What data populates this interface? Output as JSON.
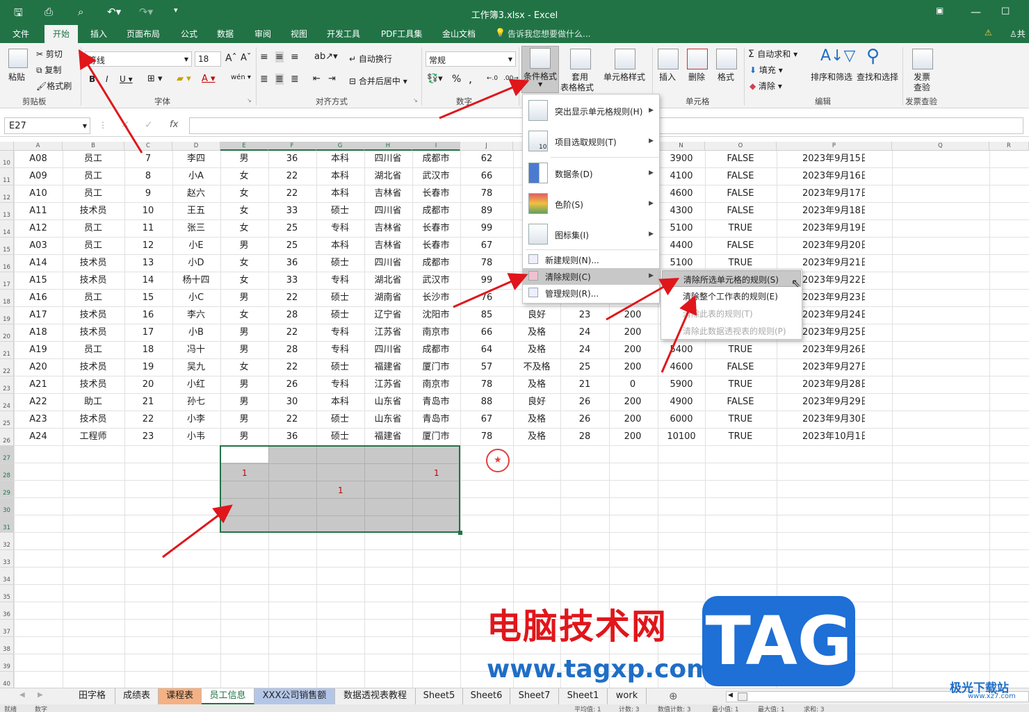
{
  "window_title": "工作簿3.xlsx - Excel",
  "ribbon_tabs": [
    "文件",
    "开始",
    "插入",
    "页面布局",
    "公式",
    "数据",
    "审阅",
    "视图",
    "开发工具",
    "PDF工具集",
    "金山文档"
  ],
  "tell_me": "告诉我您想要做什么...",
  "share_label": "共",
  "clipboard": {
    "paste": "粘贴",
    "cut": "剪切",
    "copy": "复制",
    "format_painter": "格式刷",
    "group": "剪贴板"
  },
  "font": {
    "name": "等线",
    "size": "18",
    "group": "字体"
  },
  "alignment": {
    "wrap": "自动换行",
    "merge": "合并后居中",
    "group": "对齐方式"
  },
  "number": {
    "format": "常规",
    "group": "数字"
  },
  "styles": {
    "cond_format": "条件格式",
    "table_format_1": "套用",
    "table_format_2": "表格格式",
    "cell_styles": "单元格样式"
  },
  "cells": {
    "insert": "插入",
    "delete": "删除",
    "format": "格式",
    "group": "单元格"
  },
  "editing": {
    "autosum": "自动求和",
    "fill": "填充",
    "clear": "清除",
    "sort_filter": "排序和筛选",
    "find_select": "查找和选择",
    "group": "编辑"
  },
  "invoice": {
    "label_1": "发票",
    "label_2": "查验",
    "group": "发票查验"
  },
  "name_box": "E27",
  "fx": "fx",
  "columns": [
    "A",
    "B",
    "C",
    "D",
    "E",
    "F",
    "G",
    "H",
    "I",
    "J",
    "N",
    "O",
    "P",
    "Q",
    "R"
  ],
  "row_numbers": [
    "10",
    "11",
    "12",
    "13",
    "14",
    "15",
    "16",
    "17",
    "18",
    "19",
    "20",
    "21",
    "22",
    "23",
    "24",
    "25",
    "26",
    "27",
    "28",
    "29",
    "30",
    "31",
    "32",
    "33",
    "34",
    "35",
    "36",
    "37",
    "38",
    "39",
    "40"
  ],
  "rows": [
    [
      "A08",
      "员工",
      "7",
      "李四",
      "男",
      "36",
      "本科",
      "四川省",
      "成都市",
      "62",
      "",
      "",
      "",
      "3900",
      "FALSE",
      "2023年9月15日"
    ],
    [
      "A09",
      "员工",
      "8",
      "小A",
      "女",
      "22",
      "本科",
      "湖北省",
      "武汉市",
      "66",
      "",
      "",
      "",
      "4100",
      "FALSE",
      "2023年9月16日"
    ],
    [
      "A10",
      "员工",
      "9",
      "赵六",
      "女",
      "22",
      "本科",
      "吉林省",
      "长春市",
      "78",
      "",
      "",
      "",
      "4600",
      "FALSE",
      "2023年9月17日"
    ],
    [
      "A11",
      "技术员",
      "10",
      "王五",
      "女",
      "33",
      "硕士",
      "四川省",
      "成都市",
      "89",
      "",
      "",
      "",
      "4300",
      "FALSE",
      "2023年9月18日"
    ],
    [
      "A12",
      "员工",
      "11",
      "张三",
      "女",
      "25",
      "专科",
      "吉林省",
      "长春市",
      "99",
      "",
      "",
      "",
      "5100",
      "TRUE",
      "2023年9月19日"
    ],
    [
      "A03",
      "员工",
      "12",
      "小E",
      "男",
      "25",
      "本科",
      "吉林省",
      "长春市",
      "67",
      "",
      "",
      "",
      "4400",
      "FALSE",
      "2023年9月20日"
    ],
    [
      "A14",
      "技术员",
      "13",
      "小D",
      "女",
      "36",
      "硕士",
      "四川省",
      "成都市",
      "78",
      "",
      "",
      "",
      "5100",
      "TRUE",
      "2023年9月21日"
    ],
    [
      "A15",
      "技术员",
      "14",
      "杨十四",
      "女",
      "33",
      "专科",
      "湖北省",
      "武汉市",
      "99",
      "",
      "",
      "",
      "",
      "",
      "2023年9月22日"
    ],
    [
      "A16",
      "员工",
      "15",
      "小C",
      "男",
      "22",
      "硕士",
      "湖南省",
      "长沙市",
      "76",
      "",
      "",
      "",
      "",
      "",
      "2023年9月23日"
    ],
    [
      "A17",
      "技术员",
      "16",
      "李六",
      "女",
      "28",
      "硕士",
      "辽宁省",
      "沈阳市",
      "85",
      "良好",
      "23",
      "200",
      "",
      "",
      "2023年9月24日"
    ],
    [
      "A18",
      "技术员",
      "17",
      "小B",
      "男",
      "22",
      "专科",
      "江苏省",
      "南京市",
      "66",
      "及格",
      "24",
      "200",
      "",
      "",
      "2023年9月25日"
    ],
    [
      "A19",
      "员工",
      "18",
      "冯十",
      "男",
      "28",
      "专科",
      "四川省",
      "成都市",
      "64",
      "及格",
      "24",
      "200",
      "5400",
      "TRUE",
      "2023年9月26日"
    ],
    [
      "A20",
      "技术员",
      "19",
      "吴九",
      "女",
      "22",
      "硕士",
      "福建省",
      "厦门市",
      "57",
      "不及格",
      "25",
      "200",
      "4600",
      "FALSE",
      "2023年9月27日"
    ],
    [
      "A21",
      "技术员",
      "20",
      "小红",
      "男",
      "26",
      "专科",
      "江苏省",
      "南京市",
      "78",
      "及格",
      "21",
      "0",
      "5900",
      "TRUE",
      "2023年9月28日"
    ],
    [
      "A22",
      "助工",
      "21",
      "孙七",
      "男",
      "30",
      "本科",
      "山东省",
      "青岛市",
      "88",
      "良好",
      "26",
      "200",
      "4900",
      "FALSE",
      "2023年9月29日"
    ],
    [
      "A23",
      "技术员",
      "22",
      "小李",
      "男",
      "22",
      "硕士",
      "山东省",
      "青岛市",
      "67",
      "及格",
      "26",
      "200",
      "6000",
      "TRUE",
      "2023年9月30日"
    ],
    [
      "A24",
      "工程师",
      "23",
      "小韦",
      "男",
      "36",
      "硕士",
      "福建省",
      "厦门市",
      "78",
      "及格",
      "28",
      "200",
      "10100",
      "TRUE",
      "2023年10月1日"
    ]
  ],
  "sel_values": [
    "1",
    "1",
    "1"
  ],
  "cond_menu": {
    "highlight": "突出显示单元格规则(H)",
    "topbottom": "项目选取规则(T)",
    "databar": "数据条(D)",
    "colorscale": "色阶(S)",
    "iconset": "图标集(I)",
    "new_rule": "新建规则(N)...",
    "clear_rules": "清除规则(C)",
    "manage": "管理规则(R)...",
    "icon_num": "10"
  },
  "clear_menu": {
    "selected": "清除所选单元格的规则(S)",
    "sheet": "清除整个工作表的规则(E)",
    "table": "清除此表的规则(T)",
    "pivot": "清除此数据透视表的规则(P)"
  },
  "sheet_tabs": [
    "田字格",
    "成绩表",
    "课程表",
    "员工信息",
    "XXX公司销售额",
    "数据透视表教程",
    "Sheet5",
    "Sheet6",
    "Sheet7",
    "Sheet1",
    "work"
  ],
  "status": {
    "ready": "就绪",
    "numeric": "数字",
    "avg": "平均值: 1",
    "count": "计数: 3",
    "numcount": "数值计数: 3",
    "min": "最小值: 1",
    "max": "最大值: 1",
    "sum": "求和: 3"
  },
  "watermark": {
    "cn": "电脑技术网",
    "url": "www.tagxp.com",
    "tag": "TAG",
    "site2": "极光下载站",
    "site2_url": "www.xz7.com"
  },
  "colors": {
    "excel_green": "#217346",
    "arrow_red": "#e0161b",
    "watermark_blue": "#1f6ec6"
  }
}
